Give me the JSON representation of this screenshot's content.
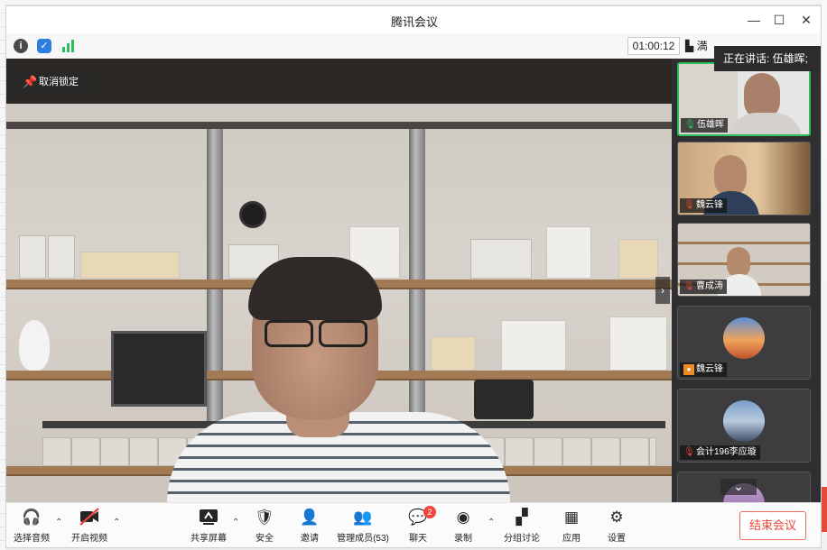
{
  "window": {
    "title": "腾讯会议",
    "minimize": "—",
    "maximize": "☐",
    "close": "✕"
  },
  "infobar": {
    "timer": "01:00:12",
    "view_label": "▙ 満",
    "speaking_tooltip": "正在讲话: 伍雄晖;"
  },
  "stage": {
    "unpin_label": "取消锁定",
    "expand_arrow": "›"
  },
  "participants": [
    {
      "name": "伍雄晖",
      "mic": "on",
      "video": true,
      "speaking": true
    },
    {
      "name": "魏云锋",
      "mic": "muted",
      "video": true
    },
    {
      "name": "曹成涛",
      "mic": "muted",
      "video": true
    },
    {
      "name": "魏云锋",
      "mic": "avatar",
      "video": false
    },
    {
      "name": "会计196李应璇",
      "mic": "muted",
      "video": false
    }
  ],
  "sidebar": {
    "more_arrow": "⌄"
  },
  "toolbar": {
    "audio": "选择音频",
    "video": "开启视频",
    "share": "共享屏幕",
    "security": "安全",
    "invite": "邀请",
    "members": "管理成员(53)",
    "chat": "聊天",
    "chat_badge": "2",
    "record": "录制",
    "breakout": "分组讨论",
    "apps": "应用",
    "settings": "设置",
    "end": "结束会议"
  },
  "colors": {
    "accent_green": "#2bbf5c",
    "end_red": "#e8453a",
    "badge_red": "#f0483e"
  }
}
